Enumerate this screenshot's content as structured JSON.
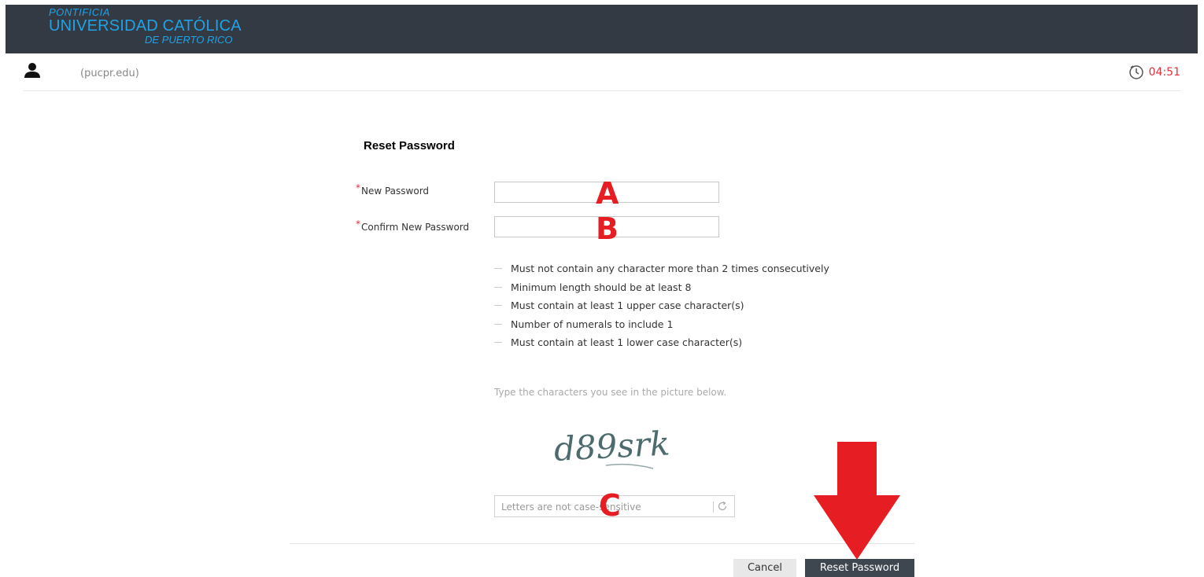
{
  "header": {
    "logo_line1": "PONTIFICIA",
    "logo_line2": "UNIVERSIDAD CATÓLICA",
    "logo_line3": "DE PUERTO RICO",
    "brand_color": "#1fa3e6",
    "bar_color": "#333a44"
  },
  "user_bar": {
    "icon": "user-icon",
    "domain": "(pucpr.edu)",
    "timer_icon": "clock-icon",
    "timer": "04:51",
    "timer_color": "#e0303a"
  },
  "form": {
    "title": "Reset Password",
    "required_mark": "*",
    "new_password_label": "New Password",
    "new_password_value": "",
    "confirm_password_label": "Confirm New Password",
    "confirm_password_value": "",
    "rules": [
      "Must not contain any character more than 2 times consecutively",
      "Minimum length should be at least 8",
      "Must contain at least 1 upper case character(s)",
      "Number of numerals to include 1",
      "Must contain at least 1 lower case character(s)"
    ],
    "captcha_hint": "Type the characters you see in the picture below.",
    "captcha_text": "d89srk",
    "captcha_placeholder": "Letters are not case-sensitive",
    "refresh_icon": "refresh-icon"
  },
  "annotations": {
    "marker_a": "A",
    "marker_b": "B",
    "marker_c": "C",
    "marker_color": "#e61e24",
    "arrow_icon": "arrow-down-icon"
  },
  "buttons": {
    "cancel": "Cancel",
    "reset": "Reset Password"
  }
}
